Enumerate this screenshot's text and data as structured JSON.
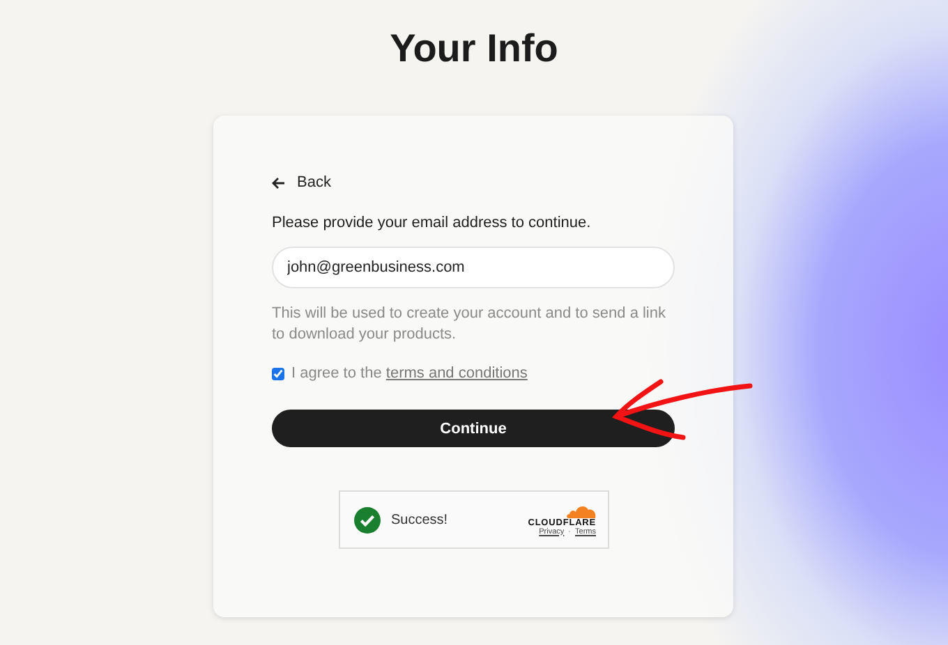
{
  "title": "Your Info",
  "card": {
    "back": "Back",
    "prompt": "Please provide your email address to continue.",
    "email": {
      "value": "john@greenbusiness.com"
    },
    "helper": "This will be used to create your account and to send a link to download your products.",
    "agree": {
      "checked": true,
      "text": "I agree to the ",
      "link": "terms and conditions"
    },
    "continue": "Continue",
    "captcha": {
      "status": "Success!",
      "brand": "CLOUDFLARE",
      "privacy": "Privacy",
      "separator": "·",
      "terms": "Terms"
    }
  }
}
